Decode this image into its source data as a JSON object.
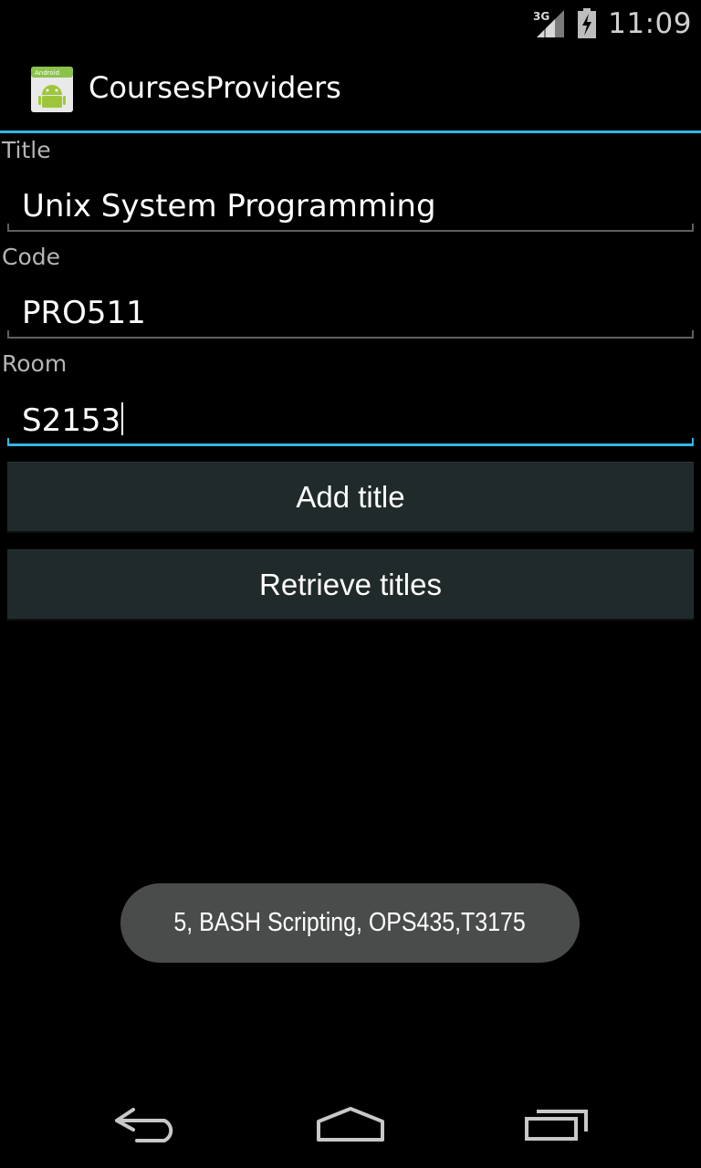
{
  "status_bar": {
    "network": "3G",
    "time": "11:09",
    "icons": [
      "signal-icon",
      "battery-charging-icon"
    ]
  },
  "action_bar": {
    "app_title": "CoursesProviders",
    "app_icon": "android-icon",
    "app_icon_caption": "Android"
  },
  "form": {
    "title_label": "Title",
    "title_value": "Unix System Programming",
    "code_label": "Code",
    "code_value": "PRO511",
    "room_label": "Room",
    "room_value": "S2153"
  },
  "buttons": {
    "add_label": "Add title",
    "retrieve_label": "Retrieve titles"
  },
  "toast": {
    "message": "5, BASH Scripting, OPS435,T3175"
  },
  "nav_bar": {
    "items": [
      "back-icon",
      "home-icon",
      "recent-apps-icon"
    ]
  },
  "colors": {
    "accent": "#33b5e5",
    "background": "#000000",
    "button_bg": "#212a2b",
    "toast_bg": "#4a4c4b"
  }
}
